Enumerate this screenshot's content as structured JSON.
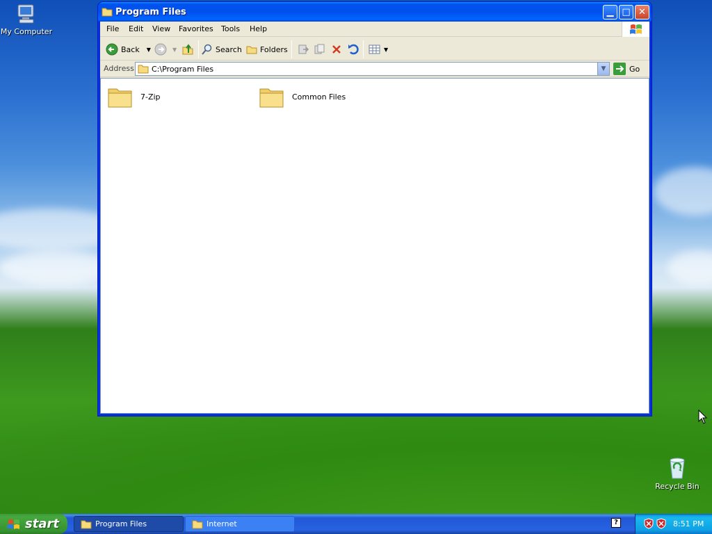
{
  "desktop": {
    "icons": [
      {
        "label": "My Computer",
        "icon": "my-computer-icon"
      },
      {
        "label": "Recycle Bin",
        "icon": "recycle-bin-icon"
      }
    ]
  },
  "window": {
    "title": "Program Files",
    "menu": [
      "File",
      "Edit",
      "View",
      "Favorites",
      "Tools",
      "Help"
    ],
    "toolbar": {
      "back": "Back",
      "search": "Search",
      "folders": "Folders"
    },
    "address": {
      "label": "Address",
      "value": "C:\\Program Files",
      "go": "Go"
    },
    "items": [
      {
        "name": "7-Zip",
        "icon": "folder-icon"
      },
      {
        "name": "Common Files",
        "icon": "folder-icon"
      }
    ]
  },
  "taskbar": {
    "start": "start",
    "tasks": [
      {
        "label": "Program Files",
        "active": true
      },
      {
        "label": "Internet",
        "active": false
      }
    ],
    "clock": "8:51 PM"
  },
  "colors": {
    "titlebar": "#0054e3",
    "start_button": "#3c9a3a",
    "tray": "#0fa1e5"
  }
}
